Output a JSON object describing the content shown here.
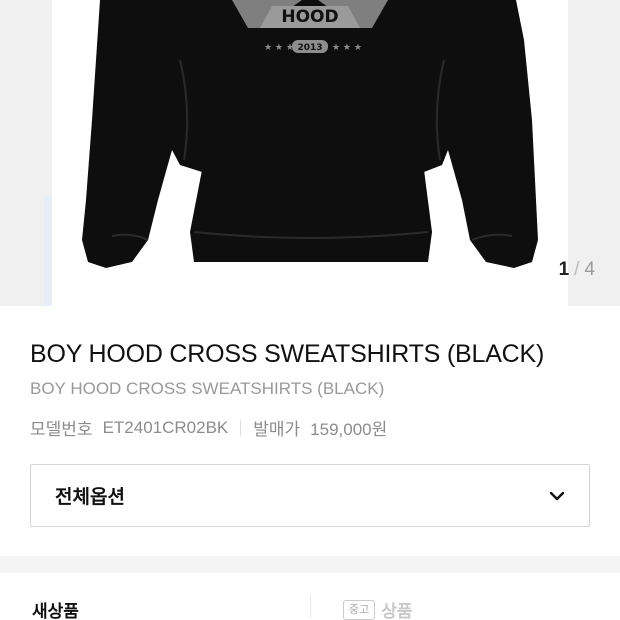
{
  "carousel": {
    "current": "1",
    "separator": "/",
    "total": "4",
    "image_icon": "black-sweatshirt-product-photo",
    "graphic_text": "HOOD",
    "graphic_year": "2013"
  },
  "product": {
    "title": "BOY HOOD CROSS SWEATSHIRTS (BLACK)",
    "subtitle": "BOY HOOD CROSS SWEATSHIRTS (BLACK)",
    "model_label": "모델번호",
    "model_value": "ET2401CR02BK",
    "price_label": "발매가",
    "price_value": "159,000원"
  },
  "options": {
    "label": "전체옵션",
    "icon": "chevron-down-icon"
  },
  "condition_tabs": {
    "new_label": "새상품",
    "used_badge": "중고",
    "used_label": "상품"
  },
  "colors": {
    "garment": "#0e0e0e",
    "graphic": "#8d8d8d",
    "muted_text": "#999999"
  }
}
